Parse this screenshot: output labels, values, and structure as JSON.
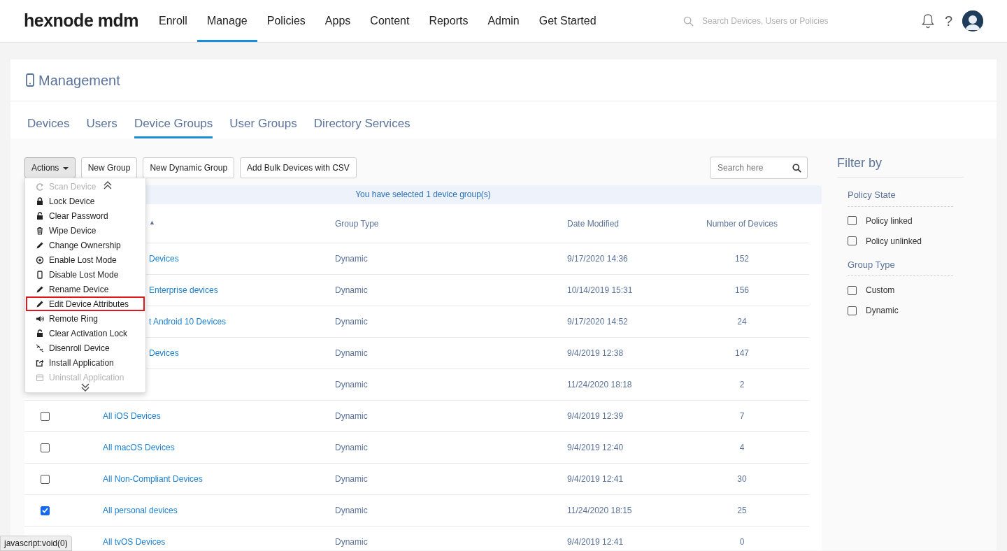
{
  "brand": "hexnode mdm",
  "nav": [
    {
      "label": "Enroll",
      "selected": false
    },
    {
      "label": "Manage",
      "selected": true
    },
    {
      "label": "Policies",
      "selected": false
    },
    {
      "label": "Apps",
      "selected": false
    },
    {
      "label": "Content",
      "selected": false
    },
    {
      "label": "Reports",
      "selected": false
    },
    {
      "label": "Admin",
      "selected": false
    },
    {
      "label": "Get Started",
      "selected": false
    }
  ],
  "global_search": {
    "placeholder": "Search Devices, Users or Policies"
  },
  "help": "?",
  "page_title": "Management",
  "tabs": [
    {
      "label": "Devices",
      "selected": false
    },
    {
      "label": "Users",
      "selected": false
    },
    {
      "label": "Device Groups",
      "selected": true
    },
    {
      "label": "User Groups",
      "selected": false
    },
    {
      "label": "Directory Services",
      "selected": false
    }
  ],
  "toolbar": {
    "actions": "Actions",
    "buttons": [
      "New Group",
      "New Dynamic Group",
      "Add Bulk Devices with CSV"
    ],
    "search": {
      "placeholder": "Search here"
    }
  },
  "actions_menu": [
    {
      "label": "Scan Device",
      "kind": "refresh",
      "faded": true,
      "selected": false
    },
    {
      "label": "Lock Device",
      "kind": "lock",
      "faded": false,
      "selected": false
    },
    {
      "label": "Clear Password",
      "kind": "unlock",
      "faded": false,
      "selected": false
    },
    {
      "label": "Wipe Device",
      "kind": "trash",
      "faded": false,
      "selected": false
    },
    {
      "label": "Change Ownership",
      "kind": "pencil",
      "faded": false,
      "selected": false
    },
    {
      "label": "Enable Lost Mode",
      "kind": "target",
      "faded": false,
      "selected": false
    },
    {
      "label": "Disable Lost Mode",
      "kind": "phone",
      "faded": false,
      "selected": false
    },
    {
      "label": "Rename Device",
      "kind": "pencil",
      "faded": false,
      "selected": false
    },
    {
      "label": "Edit Device Attributes",
      "kind": "pencil",
      "faded": false,
      "selected": true
    },
    {
      "label": "Remote Ring",
      "kind": "speaker",
      "faded": false,
      "selected": false
    },
    {
      "label": "Clear Activation Lock",
      "kind": "unlock",
      "faded": false,
      "selected": false
    },
    {
      "label": "Disenroll Device",
      "kind": "broken",
      "faded": false,
      "selected": false
    },
    {
      "label": "Install Application",
      "kind": "share",
      "faded": false,
      "selected": false
    },
    {
      "label": "Uninstall Application",
      "kind": "box",
      "faded": true,
      "selected": false
    }
  ],
  "selection_banner": "You have selected 1 device group(s)",
  "table": {
    "columns": [
      {
        "label": "▲",
        "covered": true
      },
      {
        "label": "Group Type",
        "covered": false
      },
      {
        "label": "Date Modified",
        "covered": false
      },
      {
        "label": "Number of Devices",
        "covered": false
      }
    ],
    "rows": [
      {
        "covered": true,
        "name": "Devices",
        "type": "Dynamic",
        "modified": "9/17/2020 14:36",
        "count": "152"
      },
      {
        "covered": true,
        "name": "Enterprise devices",
        "type": "Dynamic",
        "modified": "10/14/2019 15:31",
        "count": "156"
      },
      {
        "covered": true,
        "name": "t Android 10 Devices",
        "type": "Dynamic",
        "modified": "9/17/2020 14:52",
        "count": "24"
      },
      {
        "covered": true,
        "name": "Devices",
        "type": "Dynamic",
        "modified": "9/4/2019 12:38",
        "count": "147"
      },
      {
        "type": "Dynamic",
        "modified": "11/24/2020 18:18",
        "count": "2"
      },
      {
        "covered": false,
        "checked": false,
        "name": "All iOS Devices",
        "type": "Dynamic",
        "modified": "9/4/2019 12:39",
        "count": "7"
      },
      {
        "covered": false,
        "checked": false,
        "name": "All macOS Devices",
        "type": "Dynamic",
        "modified": "9/4/2019 12:40",
        "count": "4"
      },
      {
        "covered": false,
        "checked": false,
        "name": "All Non-Compliant Devices",
        "type": "Dynamic",
        "modified": "9/4/2019 12:41",
        "count": "30"
      },
      {
        "covered": false,
        "checked": true,
        "name": "All personal devices",
        "type": "Dynamic",
        "modified": "11/24/2020 18:15",
        "count": "25"
      },
      {
        "covered": false,
        "name": "All tvOS Devices",
        "type": "Dynamic",
        "modified": "9/4/2019 12:41",
        "count": "0"
      }
    ]
  },
  "filter": {
    "title": "Filter by",
    "groups": [
      {
        "heading": "Policy State",
        "options": [
          {
            "label": "Policy linked",
            "checked": false
          },
          {
            "label": "Policy unlinked",
            "checked": false
          }
        ]
      },
      {
        "heading": "Group Type",
        "options": [
          {
            "label": "Custom",
            "checked": false
          },
          {
            "label": "Dynamic",
            "checked": false
          }
        ]
      }
    ]
  },
  "status_bar": "javascript:void(0)"
}
